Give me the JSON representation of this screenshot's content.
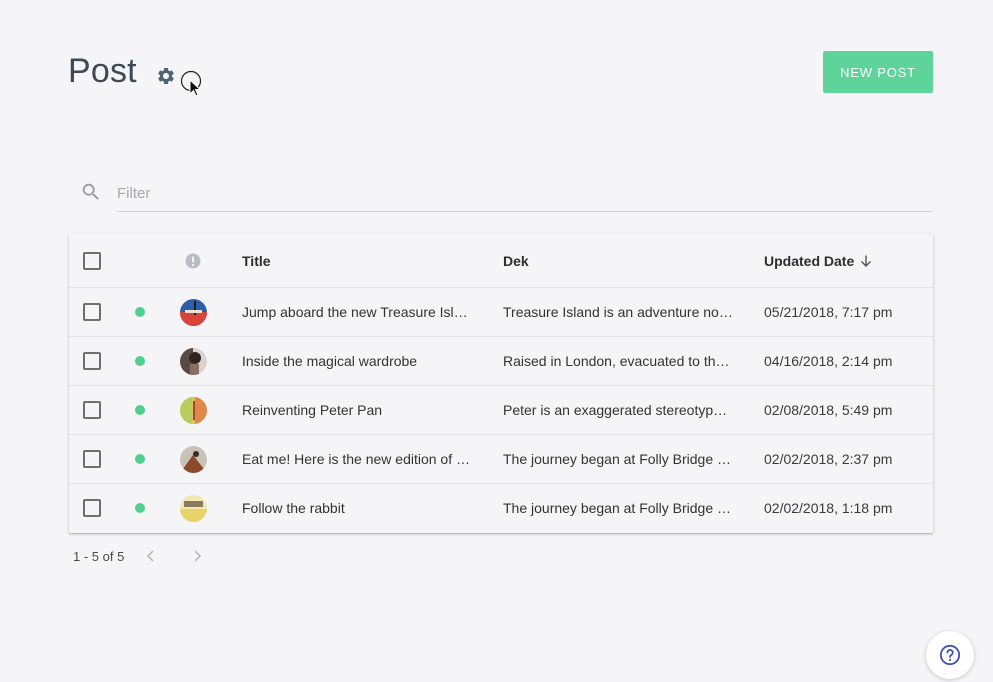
{
  "header": {
    "title": "Post",
    "new_post_label": "NEW POST"
  },
  "filter": {
    "placeholder": "Filter",
    "value": ""
  },
  "table": {
    "columns": {
      "title": "Title",
      "dek": "Dek",
      "updated": "Updated Date"
    },
    "rows": [
      {
        "title": "Jump aboard the new Treasure Isl…",
        "dek": "Treasure Island is an adventure no…",
        "updated": "05/21/2018, 7:17 pm"
      },
      {
        "title": "Inside the magical wardrobe",
        "dek": "Raised in London, evacuated to th…",
        "updated": "04/16/2018, 2:14 pm"
      },
      {
        "title": "Reinventing Peter Pan",
        "dek": "Peter is an exaggerated stereotype…",
        "updated": "02/08/2018, 5:49 pm"
      },
      {
        "title": "Eat me! Here is the new edition of …",
        "dek": "The journey began at Folly Bridge …",
        "updated": "02/02/2018, 2:37 pm"
      },
      {
        "title": "Follow the rabbit",
        "dek": "The journey began at Folly Bridge …",
        "updated": "02/02/2018, 1:18 pm"
      }
    ]
  },
  "pagination": {
    "range": "1 - 5 of 5"
  },
  "colors": {
    "accent": "#5fd49a",
    "status_published": "#4fd08e",
    "background": "#f5f5f7",
    "help_icon": "#3f51b5"
  },
  "icons": {
    "settings": "gear-icon",
    "search": "search-icon",
    "info": "info-icon",
    "sort": "arrow-down-icon",
    "prev": "chevron-left-icon",
    "next": "chevron-right-icon",
    "help": "help-circle-icon"
  }
}
